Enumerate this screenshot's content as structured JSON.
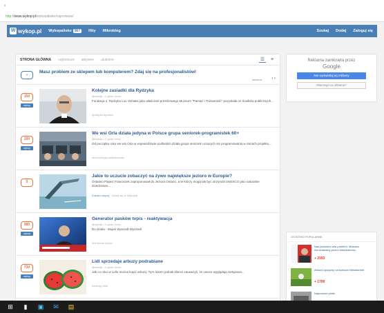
{
  "browser": {
    "back_glyph": "‹",
    "url_secure": "http://",
    "url_host": "www.wykop.pl",
    "url_path": "/wykopalisko/najnowsze/"
  },
  "nav": {
    "logo_letter": "W",
    "logo_text": "wykop.pl",
    "items": [
      "Wykopalisko",
      "Hity",
      "Mikroblog"
    ],
    "badge": "967",
    "right": [
      "Szukaj",
      "Dodaj",
      "Zaloguj się"
    ]
  },
  "tabs": [
    {
      "label": "STRONA GŁÓWNA",
      "active": true
    },
    {
      "label": "najnowsze",
      "active": false
    },
    {
      "label": "aktywne",
      "active": false
    },
    {
      "label": "ulubione",
      "active": false
    }
  ],
  "view_icons": [
    "list-view-icon",
    "grid-view-icon"
  ],
  "view_glyphs": [
    "☰",
    "≡"
  ],
  "promo": {
    "badge": "+",
    "title": "Masz problem ze sklepem lub komputerem? Zdaj się na profesjonalistów!",
    "meta": "reklama",
    "arrows": "‹ ›"
  },
  "articles": [
    {
      "votes": "150",
      "vote_label": "wykop",
      "title": "Kolejne zasiadki dla Rydzyka",
      "meta": "@wykop • 1 godz. temu",
      "body": "Fundacja o. Rydzyka Lux Veritatis jako właściciel prestiżowego Muzeum \"Pamięć i Tożsamość\" pozyskała ze środków publicznych...",
      "tags": "#polityka #polska"
    },
    {
      "votes": "200",
      "vote_label": "wykop",
      "title": "We wsi Orla działa jedyna w Polsce grupa seniorek-programistek 60+",
      "meta": "@wykop • 2 godz. temu",
      "body": "Od początku roku we wsi Orla w województwie podlaskim działa grupa seniorek uczących się programowania w ramach projektu...",
      "tags": "#technologia #ciekawostki"
    },
    {
      "votes": "0",
      "vote_label": "",
      "title": "Jakie to uczucie zobaczyć na żywo największe jezioro w Europie?",
      "meta": "",
      "body": "Ostatnio Papież Franciszek zaproponował do Jeziora Ontario, a te którzy mogą tak być otrzymali UNESCO jako naturalne dziedzictwo...",
      "tags": "Dodaj się w Wykopie",
      "tags_link": "Zobacz więcej"
    },
    {
      "votes": "980",
      "vote_label": "wykop",
      "title": "Generator pasków tvpis - reaktywacja",
      "meta": "@wykop • 3 godz. temu",
      "body": "Do dzieła - Wujek Wyszedł Wyszedł",
      "tags": "#heheszki #tvpis"
    },
    {
      "votes": "730",
      "vote_label": "wykop",
      "title": "Lidl sprzedaje arbuzy podrabiane",
      "meta": "@wykop • 4 godz. temu",
      "body": "Jak co roku w Lidlu można kupić arbuzy. Tym razem jednak klienci zauważyli, że owoce wyglądają nietypowo...",
      "tags": "#zakupy #lidl"
    }
  ],
  "sidebar": {
    "ad_line1": "Reklama zamknięta przez",
    "ad_line2": "Google",
    "ad_btn": "Nie wyświetlaj tej reklamy",
    "ad_btn2": "Dlaczego ta reklama?",
    "popular_head": "OSTATNIO POPULARNE",
    "popular": [
      {
        "text": "Nad jeziorami wisi problem. Masowo nieuznawany przez mieszkańców...",
        "count": "+ 2093"
      },
      {
        "text": "Absurd ojczyzny na kontach Nieustannie",
        "count": "+ 1789"
      },
      {
        "text": "Najnowsze plotki",
        "count": ""
      }
    ]
  },
  "taskbar": [
    "start-icon",
    "file-explorer-icon",
    "store-icon",
    "mail-icon",
    "folder-icon"
  ],
  "taskbar_glyphs": [
    "⊞",
    "▮",
    "▣",
    "✉",
    "▤"
  ],
  "colors": {
    "accent": "#4a7fb5",
    "vote": "#e8713a",
    "link": "#2a5a93",
    "count": "#e53935"
  }
}
